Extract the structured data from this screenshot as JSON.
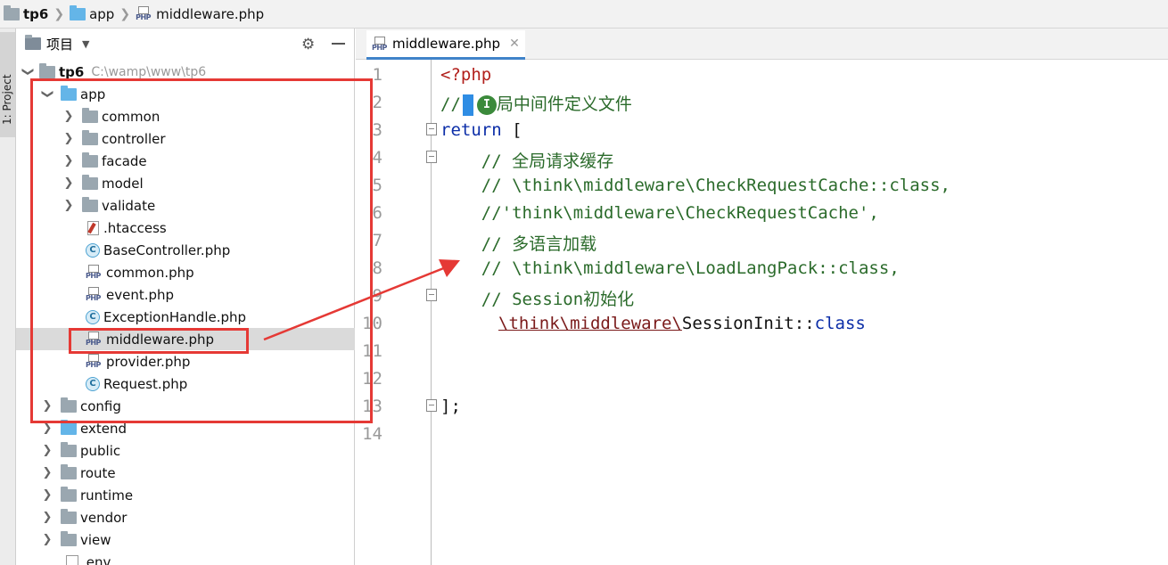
{
  "breadcrumb": {
    "project": "tp6",
    "folder": "app",
    "file": "middleware.php"
  },
  "toolstrip": {
    "label": "1: Project"
  },
  "panel": {
    "title": "项目",
    "root": {
      "name": "tp6",
      "path": "C:\\wamp\\www\\tp6"
    },
    "items": [
      {
        "label": "app"
      },
      {
        "label": "common"
      },
      {
        "label": "controller"
      },
      {
        "label": "facade"
      },
      {
        "label": "model"
      },
      {
        "label": "validate"
      },
      {
        "label": ".htaccess"
      },
      {
        "label": "BaseController.php"
      },
      {
        "label": "common.php"
      },
      {
        "label": "event.php"
      },
      {
        "label": "ExceptionHandle.php"
      },
      {
        "label": "middleware.php"
      },
      {
        "label": "provider.php"
      },
      {
        "label": "Request.php"
      },
      {
        "label": "config"
      },
      {
        "label": "extend"
      },
      {
        "label": "public"
      },
      {
        "label": "route"
      },
      {
        "label": "runtime"
      },
      {
        "label": "vendor"
      },
      {
        "label": "view"
      },
      {
        "label": ".env"
      }
    ]
  },
  "editor": {
    "tab_label": "middleware.php",
    "line_numbers": [
      "1",
      "2",
      "3",
      "4",
      "5",
      "6",
      "7",
      "8",
      "9",
      "10",
      "11",
      "12",
      "13",
      "14"
    ],
    "lines": {
      "l1": "<?php",
      "l2a": "//",
      "l2b": "局中间件定义文件",
      "l3a": "return",
      "l3b": " [",
      "l4": "    // 全局请求缓存",
      "l5": "    // \\think\\middleware\\CheckRequestCache::class,",
      "l6": "    //'think\\middleware\\CheckRequestCache',",
      "l7": "    // 多语言加载",
      "l8": "    // \\think\\middleware\\LoadLangPack::class,",
      "l9": "    // Session初始化",
      "l10a": "\\think\\middleware\\",
      "l10b": "SessionInit",
      "l10c": "::",
      "l10d": "class",
      "l13": "];"
    }
  },
  "colors": {
    "annotation": "#e53935",
    "accent": "#4083c9"
  }
}
